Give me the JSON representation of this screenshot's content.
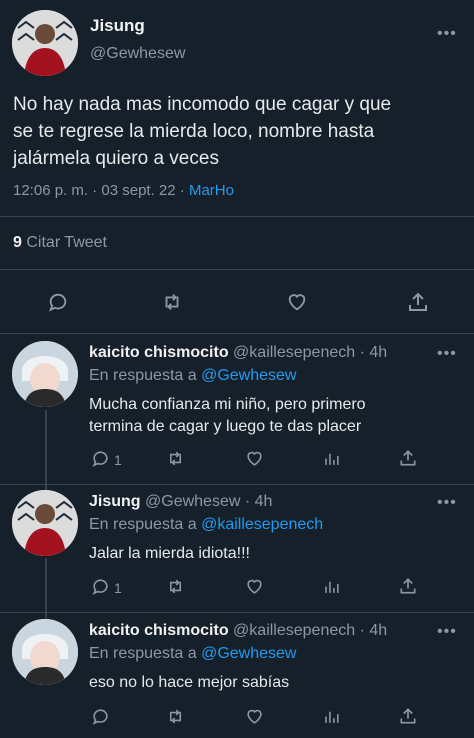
{
  "main_tweet": {
    "author_name": "Jisung",
    "author_handle": "@Gewhesew",
    "text_lines": [
      "No hay nada mas incomodo que cagar y que",
      "se te regrese la mierda loco, nombre hasta",
      "jalármela quiero a veces"
    ],
    "time": "12:06 p. m.",
    "date": "03 sept. 22",
    "source": "MarHo",
    "quote_count": "9",
    "quote_label": "Citar Tweet"
  },
  "replies": [
    {
      "author_name": "kaicito chismocito",
      "author_handle": "@kaillesepenech",
      "age": "4h",
      "reply_prefix": "En respuesta a",
      "reply_to": "@Gewhesew",
      "text_lines": [
        "Mucha confianza mi niño, pero primero",
        "termina de cagar y luego te das placer"
      ],
      "reply_count": "1"
    },
    {
      "author_name": "Jisung",
      "author_handle": "@Gewhesew",
      "age": "4h",
      "reply_prefix": "En respuesta a",
      "reply_to": "@kaillesepenech",
      "text_lines": [
        "Jalar la mierda idiota!!!"
      ],
      "reply_count": "1"
    },
    {
      "author_name": "kaicito chismocito",
      "author_handle": "@kaillesepenech",
      "age": "4h",
      "reply_prefix": "En respuesta a",
      "reply_to": "@Gewhesew",
      "text_lines": [
        "eso no lo hace mejor sabías"
      ],
      "reply_count": ""
    }
  ],
  "separator": "·",
  "more_glyph": "•••",
  "icons": [
    "reply-icon",
    "retweet-icon",
    "like-icon",
    "analytics-icon",
    "share-icon",
    "more-options-icon"
  ],
  "colors": {
    "background": "#15202b",
    "accent": "#1d9bf0",
    "muted": "#8b98a5",
    "text": "#d9d9d9"
  }
}
